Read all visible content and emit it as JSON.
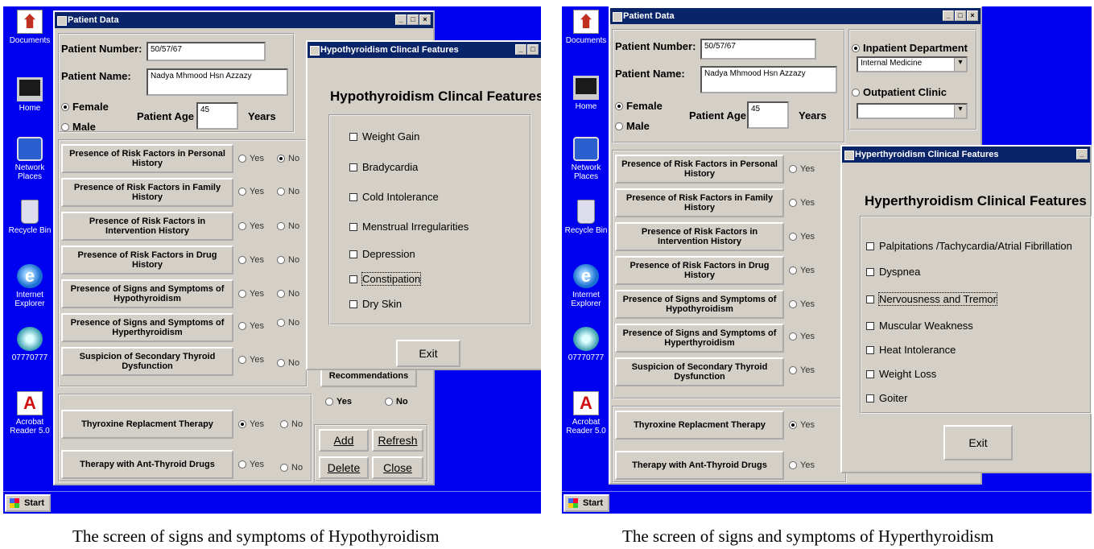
{
  "desktop_icons": [
    "Documents",
    "Home",
    "Network Places",
    "Recycle Bin",
    "Internet Explorer",
    "07770777",
    "Acrobat Reader 5.0"
  ],
  "start_label": "Start",
  "patient_window": {
    "title": "Patient Data",
    "patient_number_label": "Patient Number:",
    "patient_number_value": "50/57/67",
    "patient_name_label": "Patient Name:",
    "patient_name_value": "Nadya Mhmood Hsn Azzazy",
    "female_label": "Female",
    "male_label": "Male",
    "age_label": "Patient Age",
    "age_value": "45",
    "years_label": "Years",
    "yes": "Yes",
    "no": "No",
    "risk_buttons": [
      "Presence of Risk Factors in Personal History",
      "Presence of Risk Factors in Family History",
      "Presence of Risk Factors in Intervention History",
      "Presence of Risk Factors in Drug History",
      "Presence of Signs and Symptoms of Hypothyroidism",
      "Presence of Signs and Symptoms of Hyperthyroidism",
      "Suspicion of Secondary Thyroid Dysfunction"
    ],
    "therapy_buttons": [
      "Thyroxine Replacment Therapy",
      "Therapy  with Ant-Thyroid Drugs"
    ],
    "recommendations_label": "Recommendations",
    "add_label": "Add",
    "refresh_label": "Refresh",
    "delete_label": "Delete",
    "close_label": "Close",
    "inpatient_label": "Inpatient Department",
    "inpatient_value": "Internal Medicine",
    "outpatient_label": "Outpatient Clinic"
  },
  "hypo_window": {
    "title": "Hypothyroidism Clincal Features",
    "heading": "Hypothyroidism Clincal Features",
    "features": [
      "Weight Gain",
      "Bradycardia",
      "Cold  Intolerance",
      "Menstrual Irregularities",
      "Depression",
      "Constipation",
      "Dry Skin"
    ],
    "exit_label": "Exit"
  },
  "hyper_window": {
    "title": "Hyperthyroidism Clinical Features",
    "heading": "Hyperthyroidism Clinical  Features",
    "features": [
      "Palpitations /Tachycardia/Atrial Fibrillation",
      "Dyspnea",
      "Nervousness and Tremor",
      "Muscular Weakness",
      "Heat Intolerance",
      "Weight Loss",
      "Goiter"
    ],
    "exit_label": "Exit"
  },
  "captions": {
    "left": "The screen of signs and symptoms of Hypothyroidism",
    "right": "The screen of signs and symptoms of Hyperthyroidism"
  },
  "colors": {
    "desktop": "#0000f0",
    "titlebar": "#0a246a",
    "window": "#d4d0c8"
  }
}
